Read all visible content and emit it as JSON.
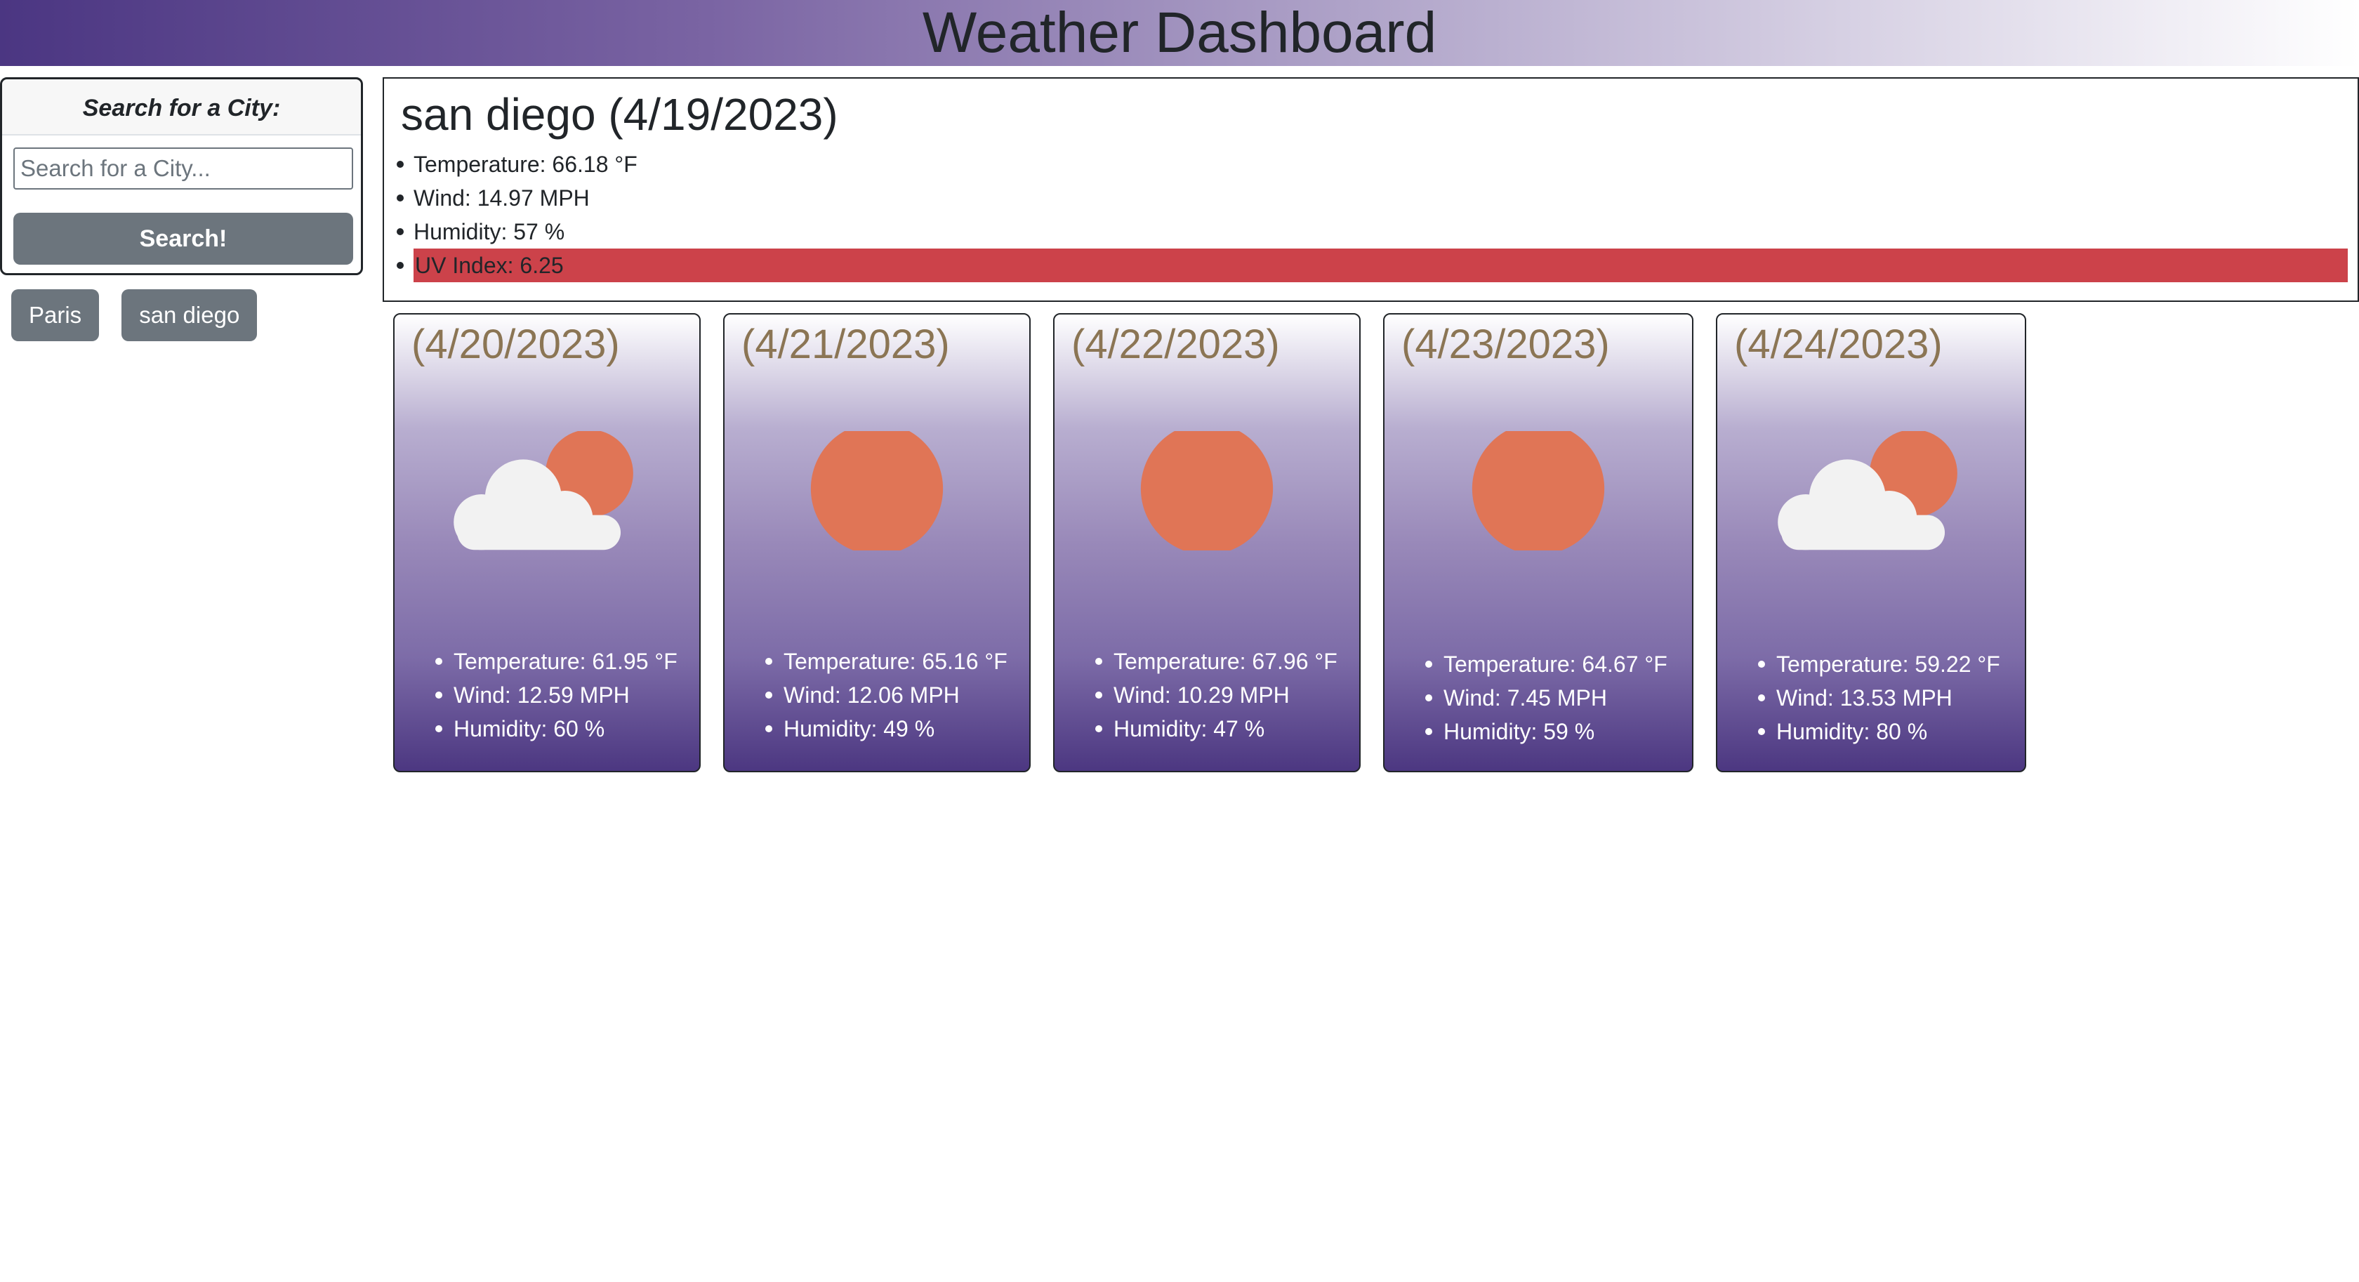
{
  "header": {
    "title": "Weather Dashboard"
  },
  "sidebar": {
    "search_title": "Search for a City:",
    "search_placeholder": "Search for a City...",
    "search_value": "",
    "search_button": "Search!",
    "history": [
      "Paris",
      "san diego"
    ]
  },
  "current": {
    "heading": "san diego (4/19/2023)",
    "items": [
      "Temperature: 66.18 °F",
      "Wind: 14.97 MPH",
      "Humidity: 57 %",
      "UV Index: 6.25"
    ],
    "uv_color": "#cc424a"
  },
  "forecast": [
    {
      "date": "(4/20/2023)",
      "icon": "partly-cloudy-icon",
      "temp": "Temperature: 61.95 °F",
      "wind": "Wind: 12.59 MPH",
      "humidity": "Humidity: 60 %"
    },
    {
      "date": "(4/21/2023)",
      "icon": "sun-icon",
      "temp": "Temperature: 65.16 °F",
      "wind": "Wind: 12.06 MPH",
      "humidity": "Humidity: 49 %"
    },
    {
      "date": "(4/22/2023)",
      "icon": "sun-icon",
      "temp": "Temperature: 67.96 °F",
      "wind": "Wind: 10.29 MPH",
      "humidity": "Humidity: 47 %"
    },
    {
      "date": "(4/23/2023)",
      "icon": "sun-icon",
      "temp": "Temperature: 64.67 °F",
      "wind": "Wind: 7.45 MPH",
      "humidity": "Humidity: 59 %"
    },
    {
      "date": "(4/24/2023)",
      "icon": "partly-cloudy-icon",
      "temp": "Temperature: 59.22 °F",
      "wind": "Wind: 13.53 MPH",
      "humidity": "Humidity: 80 %"
    }
  ],
  "colors": {
    "header_start": "#4b3682",
    "button": "#6c757d",
    "sun": "#e07556",
    "date_text": "#8b7554"
  }
}
